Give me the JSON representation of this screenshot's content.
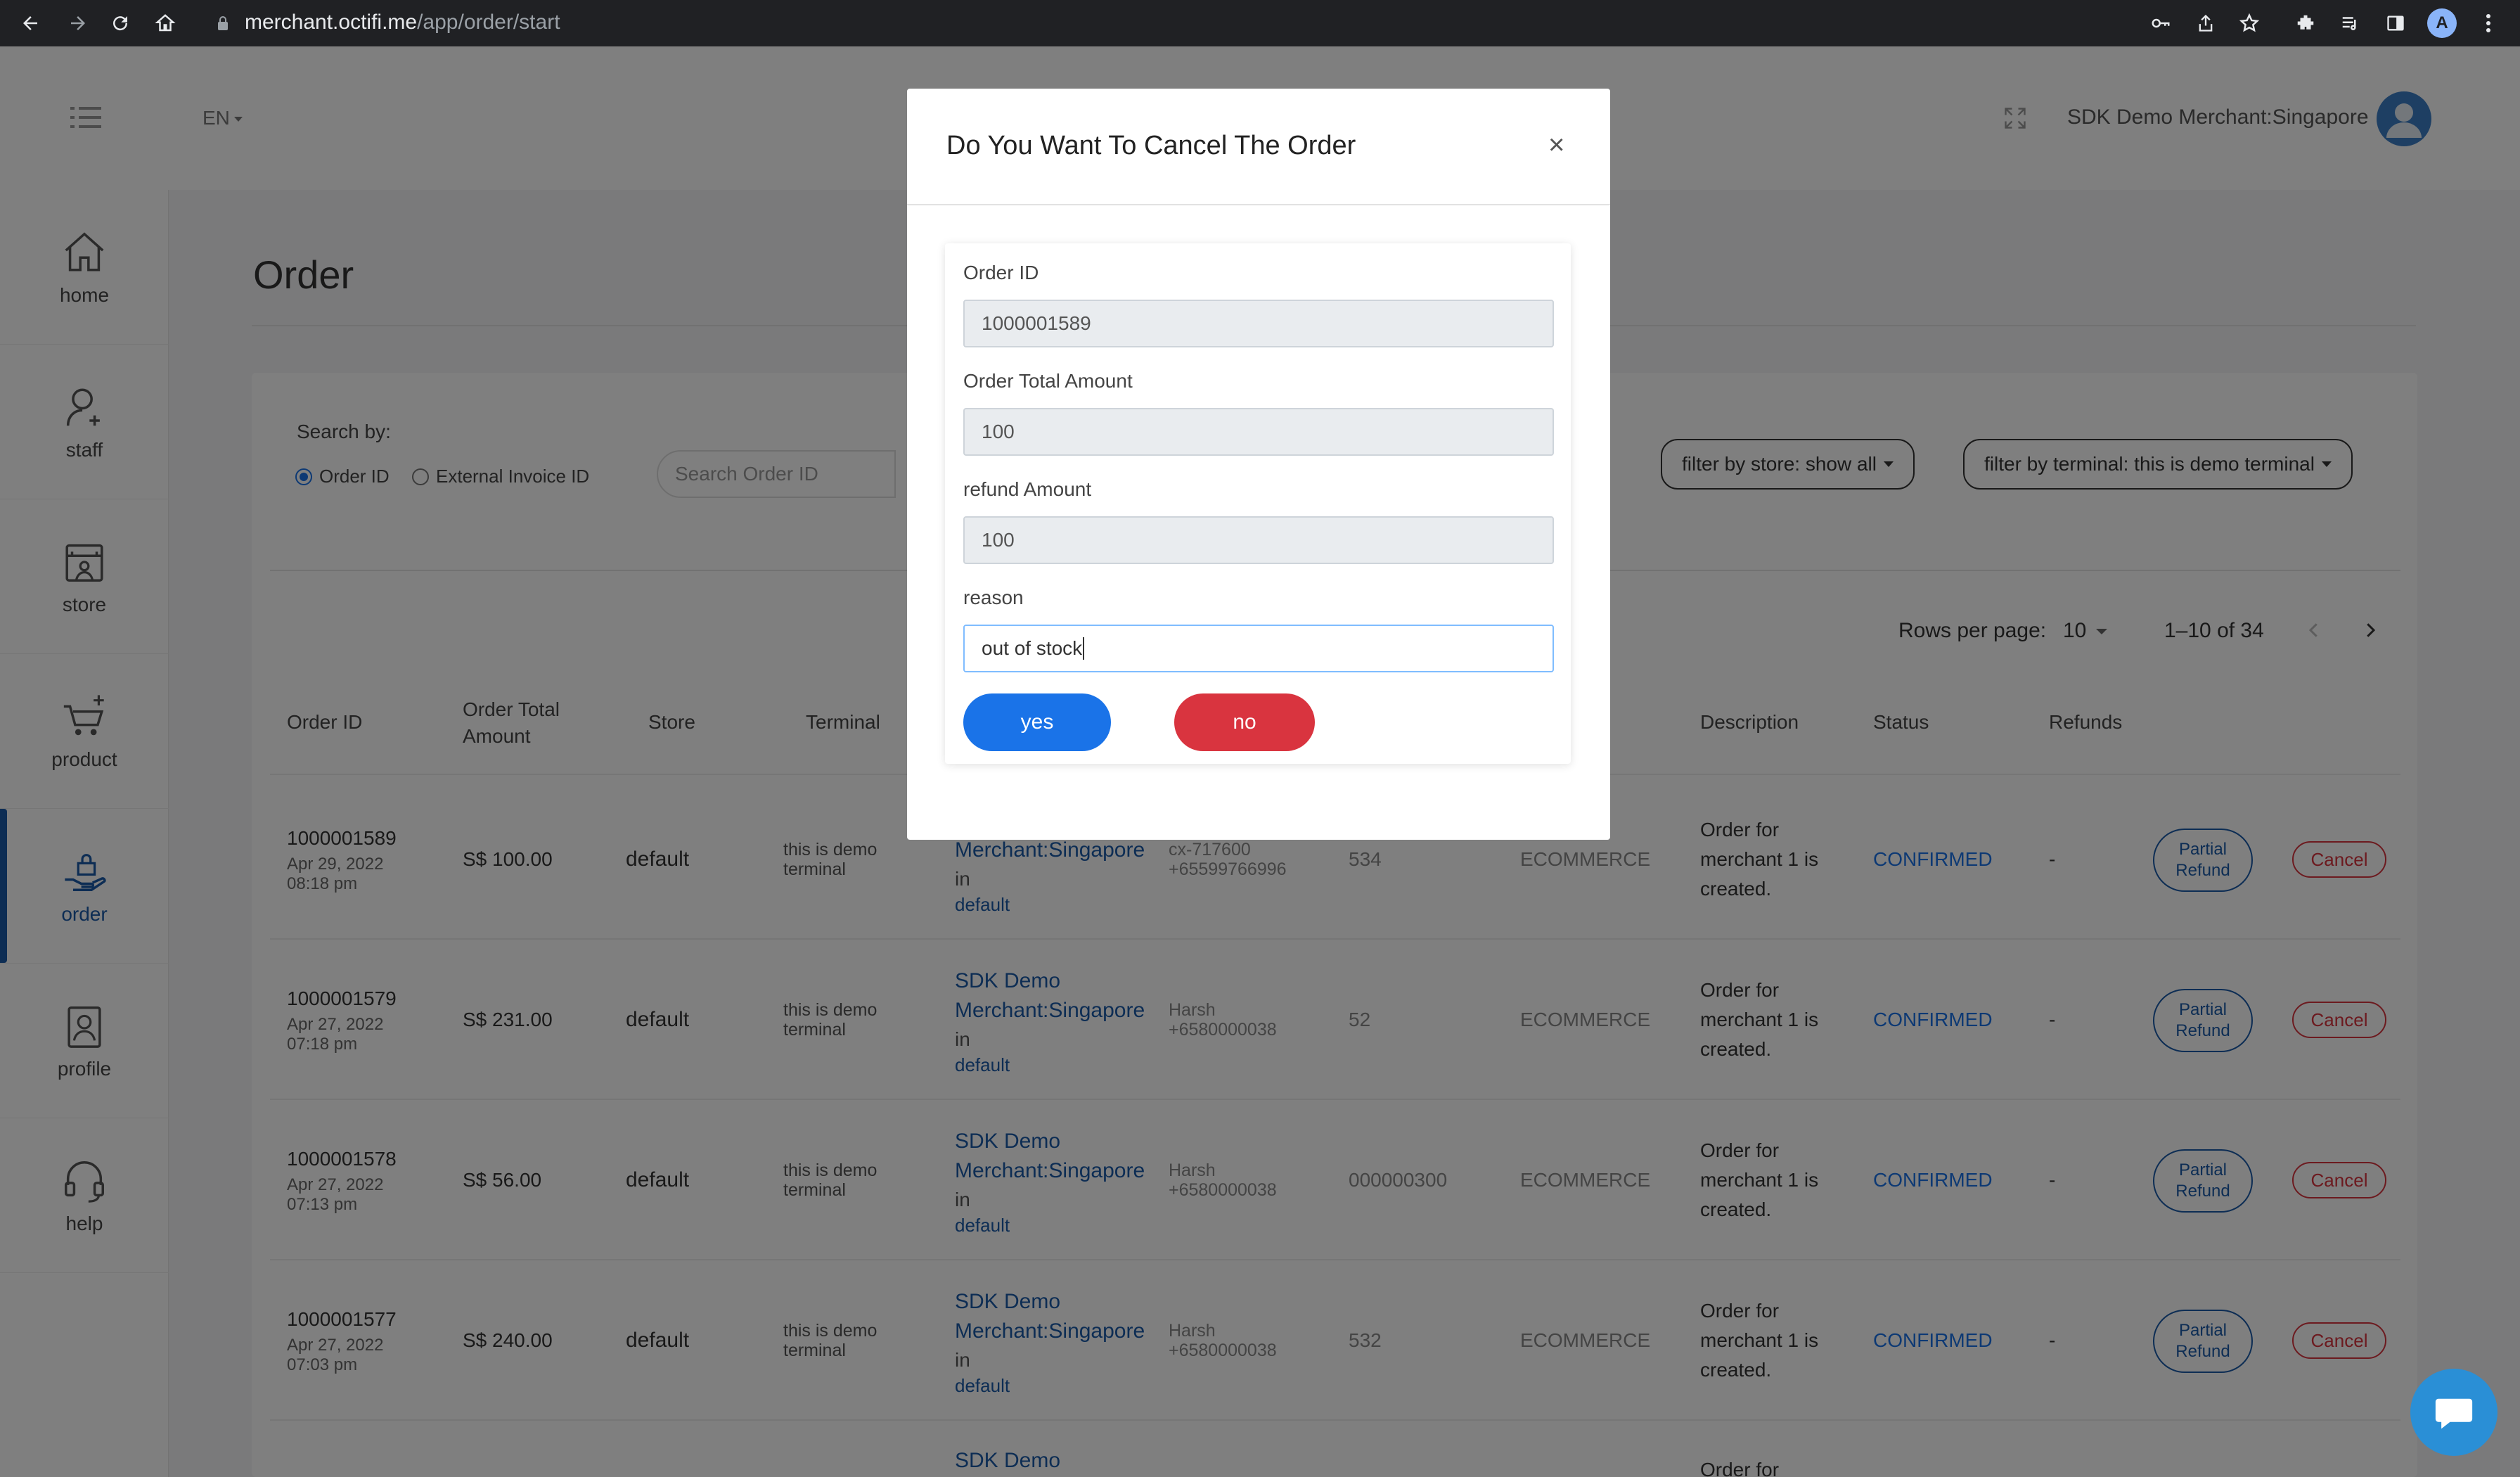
{
  "browser": {
    "url_host": "merchant.octifi.me",
    "url_path": "/app/order/start",
    "profile_initial": "A"
  },
  "header": {
    "language": "EN",
    "merchant_name": "SDK Demo Merchant:Singapore"
  },
  "sidebar": {
    "items": [
      {
        "label": "home",
        "icon": "home-icon"
      },
      {
        "label": "staff",
        "icon": "staff-icon"
      },
      {
        "label": "store",
        "icon": "store-icon"
      },
      {
        "label": "product",
        "icon": "product-icon"
      },
      {
        "label": "order",
        "icon": "order-icon",
        "active": true
      },
      {
        "label": "profile",
        "icon": "profile-icon"
      },
      {
        "label": "help",
        "icon": "help-icon"
      }
    ]
  },
  "page": {
    "title": "Order",
    "search_by_label": "Search by:",
    "radio_order_id": "Order ID",
    "radio_external_invoice": "External Invoice ID",
    "search_placeholder": "Search Order ID",
    "filter_store": "filter by store: show all",
    "filter_terminal": "filter by terminal: this is demo terminal",
    "rows_per_page_label": "Rows per page:",
    "rows_per_page_value": "10",
    "page_range": "1–10 of 34"
  },
  "table": {
    "headers": {
      "order_id": "Order ID",
      "total_amount": "Order Total Amount",
      "store": "Store",
      "terminal": "Terminal",
      "description": "Description",
      "status": "Status",
      "refunds": "Refunds"
    },
    "rows": [
      {
        "id": "1000001589",
        "date": "Apr 29, 2022",
        "time": "08:18 pm",
        "amount": "S$ 100.00",
        "store": "default",
        "terminal_1": "this is demo",
        "terminal_2": "terminal",
        "merchant_1": "",
        "merchant_2": "Merchant:Singapore",
        "in": "in",
        "merchant_store": "default",
        "customer_1": "cx-717600",
        "customer_2": "+65599766996",
        "ref": "534",
        "channel": "ECOMMERCE",
        "desc_1": "Order for",
        "desc_2": "merchant 1 is",
        "desc_3": "created.",
        "status": "CONFIRMED",
        "refunds": "-",
        "partial_1": "Partial",
        "partial_2": "Refund",
        "cancel": "Cancel"
      },
      {
        "id": "1000001579",
        "date": "Apr 27, 2022",
        "time": "07:18 pm",
        "amount": "S$ 231.00",
        "store": "default",
        "terminal_1": "this is demo",
        "terminal_2": "terminal",
        "merchant_1": "SDK Demo",
        "merchant_2": "Merchant:Singapore",
        "in": "in",
        "merchant_store": "default",
        "customer_1": "Harsh",
        "customer_2": "+6580000038",
        "ref": "52",
        "channel": "ECOMMERCE",
        "desc_1": "Order for",
        "desc_2": "merchant 1 is",
        "desc_3": "created.",
        "status": "CONFIRMED",
        "refunds": "-",
        "partial_1": "Partial",
        "partial_2": "Refund",
        "cancel": "Cancel"
      },
      {
        "id": "1000001578",
        "date": "Apr 27, 2022",
        "time": "07:13 pm",
        "amount": "S$ 56.00",
        "store": "default",
        "terminal_1": "this is demo",
        "terminal_2": "terminal",
        "merchant_1": "SDK Demo",
        "merchant_2": "Merchant:Singapore",
        "in": "in",
        "merchant_store": "default",
        "customer_1": "Harsh",
        "customer_2": "+6580000038",
        "ref": "000000300",
        "channel": "ECOMMERCE",
        "desc_1": "Order for",
        "desc_2": "merchant 1 is",
        "desc_3": "created.",
        "status": "CONFIRMED",
        "refunds": "-",
        "partial_1": "Partial",
        "partial_2": "Refund",
        "cancel": "Cancel"
      },
      {
        "id": "1000001577",
        "date": "Apr 27, 2022",
        "time": "07:03 pm",
        "amount": "S$ 240.00",
        "store": "default",
        "terminal_1": "this is demo",
        "terminal_2": "terminal",
        "merchant_1": "SDK Demo",
        "merchant_2": "Merchant:Singapore",
        "in": "in",
        "merchant_store": "default",
        "customer_1": "Harsh",
        "customer_2": "+6580000038",
        "ref": "532",
        "channel": "ECOMMERCE",
        "desc_1": "Order for",
        "desc_2": "merchant 1 is",
        "desc_3": "created.",
        "status": "CONFIRMED",
        "refunds": "-",
        "partial_1": "Partial",
        "partial_2": "Refund",
        "cancel": "Cancel"
      },
      {
        "id": "",
        "merchant_1": "SDK Demo",
        "desc_1": "Order for"
      }
    ]
  },
  "modal": {
    "title": "Do You Want To Cancel The Order",
    "close": "×",
    "order_id_label": "Order ID",
    "order_id_value": "1000001589",
    "total_label": "Order Total Amount",
    "total_value": "100",
    "refund_label": "refund Amount",
    "refund_value": "100",
    "reason_label": "reason",
    "reason_value": "out of stock",
    "yes_label": "yes",
    "no_label": "no"
  },
  "colors": {
    "primary": "#1a73e8",
    "brand_blue": "#1a5aa8",
    "danger": "#d9343f",
    "chrome_bg": "#202124"
  }
}
